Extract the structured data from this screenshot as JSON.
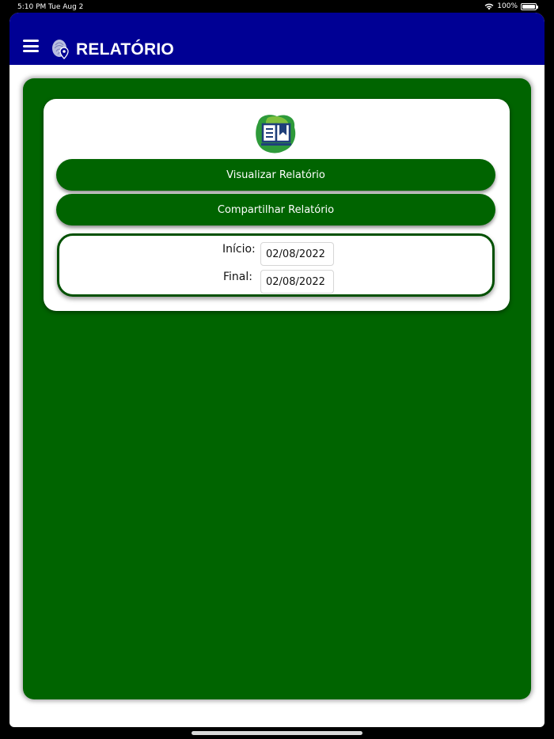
{
  "status_bar": {
    "time": "5:10 PM",
    "date": "Tue Aug 2",
    "battery": "100%",
    "icons": [
      "wifi-icon",
      "battery-icon"
    ]
  },
  "header": {
    "title": "RELATÓRIO",
    "menu_icon": "hamburger-menu-icon",
    "logo_icon": "fingerprint-location-icon",
    "background_color": "#000094"
  },
  "report": {
    "icon": "book-report-icon",
    "visualize_label": "Visualizar Relatório",
    "share_label": "Compartilhar Relatório",
    "start_label": "Início:",
    "start_value": "02/08/2022",
    "end_label": "Final:",
    "end_value": "02/08/2022"
  },
  "colors": {
    "panel": "#006400",
    "header": "#000094",
    "card": "#ffffff"
  }
}
